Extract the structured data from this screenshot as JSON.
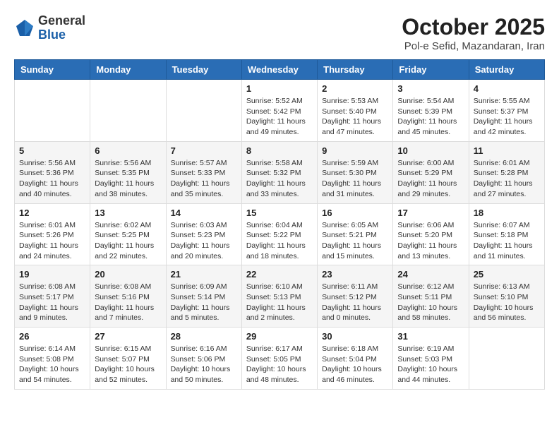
{
  "logo": {
    "general": "General",
    "blue": "Blue"
  },
  "title": "October 2025",
  "location": "Pol-e Sefid, Mazandaran, Iran",
  "headers": [
    "Sunday",
    "Monday",
    "Tuesday",
    "Wednesday",
    "Thursday",
    "Friday",
    "Saturday"
  ],
  "weeks": [
    [
      {
        "day": "",
        "info": ""
      },
      {
        "day": "",
        "info": ""
      },
      {
        "day": "",
        "info": ""
      },
      {
        "day": "1",
        "info": "Sunrise: 5:52 AM\nSunset: 5:42 PM\nDaylight: 11 hours\nand 49 minutes."
      },
      {
        "day": "2",
        "info": "Sunrise: 5:53 AM\nSunset: 5:40 PM\nDaylight: 11 hours\nand 47 minutes."
      },
      {
        "day": "3",
        "info": "Sunrise: 5:54 AM\nSunset: 5:39 PM\nDaylight: 11 hours\nand 45 minutes."
      },
      {
        "day": "4",
        "info": "Sunrise: 5:55 AM\nSunset: 5:37 PM\nDaylight: 11 hours\nand 42 minutes."
      }
    ],
    [
      {
        "day": "5",
        "info": "Sunrise: 5:56 AM\nSunset: 5:36 PM\nDaylight: 11 hours\nand 40 minutes."
      },
      {
        "day": "6",
        "info": "Sunrise: 5:56 AM\nSunset: 5:35 PM\nDaylight: 11 hours\nand 38 minutes."
      },
      {
        "day": "7",
        "info": "Sunrise: 5:57 AM\nSunset: 5:33 PM\nDaylight: 11 hours\nand 35 minutes."
      },
      {
        "day": "8",
        "info": "Sunrise: 5:58 AM\nSunset: 5:32 PM\nDaylight: 11 hours\nand 33 minutes."
      },
      {
        "day": "9",
        "info": "Sunrise: 5:59 AM\nSunset: 5:30 PM\nDaylight: 11 hours\nand 31 minutes."
      },
      {
        "day": "10",
        "info": "Sunrise: 6:00 AM\nSunset: 5:29 PM\nDaylight: 11 hours\nand 29 minutes."
      },
      {
        "day": "11",
        "info": "Sunrise: 6:01 AM\nSunset: 5:28 PM\nDaylight: 11 hours\nand 27 minutes."
      }
    ],
    [
      {
        "day": "12",
        "info": "Sunrise: 6:01 AM\nSunset: 5:26 PM\nDaylight: 11 hours\nand 24 minutes."
      },
      {
        "day": "13",
        "info": "Sunrise: 6:02 AM\nSunset: 5:25 PM\nDaylight: 11 hours\nand 22 minutes."
      },
      {
        "day": "14",
        "info": "Sunrise: 6:03 AM\nSunset: 5:23 PM\nDaylight: 11 hours\nand 20 minutes."
      },
      {
        "day": "15",
        "info": "Sunrise: 6:04 AM\nSunset: 5:22 PM\nDaylight: 11 hours\nand 18 minutes."
      },
      {
        "day": "16",
        "info": "Sunrise: 6:05 AM\nSunset: 5:21 PM\nDaylight: 11 hours\nand 15 minutes."
      },
      {
        "day": "17",
        "info": "Sunrise: 6:06 AM\nSunset: 5:20 PM\nDaylight: 11 hours\nand 13 minutes."
      },
      {
        "day": "18",
        "info": "Sunrise: 6:07 AM\nSunset: 5:18 PM\nDaylight: 11 hours\nand 11 minutes."
      }
    ],
    [
      {
        "day": "19",
        "info": "Sunrise: 6:08 AM\nSunset: 5:17 PM\nDaylight: 11 hours\nand 9 minutes."
      },
      {
        "day": "20",
        "info": "Sunrise: 6:08 AM\nSunset: 5:16 PM\nDaylight: 11 hours\nand 7 minutes."
      },
      {
        "day": "21",
        "info": "Sunrise: 6:09 AM\nSunset: 5:14 PM\nDaylight: 11 hours\nand 5 minutes."
      },
      {
        "day": "22",
        "info": "Sunrise: 6:10 AM\nSunset: 5:13 PM\nDaylight: 11 hours\nand 2 minutes."
      },
      {
        "day": "23",
        "info": "Sunrise: 6:11 AM\nSunset: 5:12 PM\nDaylight: 11 hours\nand 0 minutes."
      },
      {
        "day": "24",
        "info": "Sunrise: 6:12 AM\nSunset: 5:11 PM\nDaylight: 10 hours\nand 58 minutes."
      },
      {
        "day": "25",
        "info": "Sunrise: 6:13 AM\nSunset: 5:10 PM\nDaylight: 10 hours\nand 56 minutes."
      }
    ],
    [
      {
        "day": "26",
        "info": "Sunrise: 6:14 AM\nSunset: 5:08 PM\nDaylight: 10 hours\nand 54 minutes."
      },
      {
        "day": "27",
        "info": "Sunrise: 6:15 AM\nSunset: 5:07 PM\nDaylight: 10 hours\nand 52 minutes."
      },
      {
        "day": "28",
        "info": "Sunrise: 6:16 AM\nSunset: 5:06 PM\nDaylight: 10 hours\nand 50 minutes."
      },
      {
        "day": "29",
        "info": "Sunrise: 6:17 AM\nSunset: 5:05 PM\nDaylight: 10 hours\nand 48 minutes."
      },
      {
        "day": "30",
        "info": "Sunrise: 6:18 AM\nSunset: 5:04 PM\nDaylight: 10 hours\nand 46 minutes."
      },
      {
        "day": "31",
        "info": "Sunrise: 6:19 AM\nSunset: 5:03 PM\nDaylight: 10 hours\nand 44 minutes."
      },
      {
        "day": "",
        "info": ""
      }
    ]
  ]
}
